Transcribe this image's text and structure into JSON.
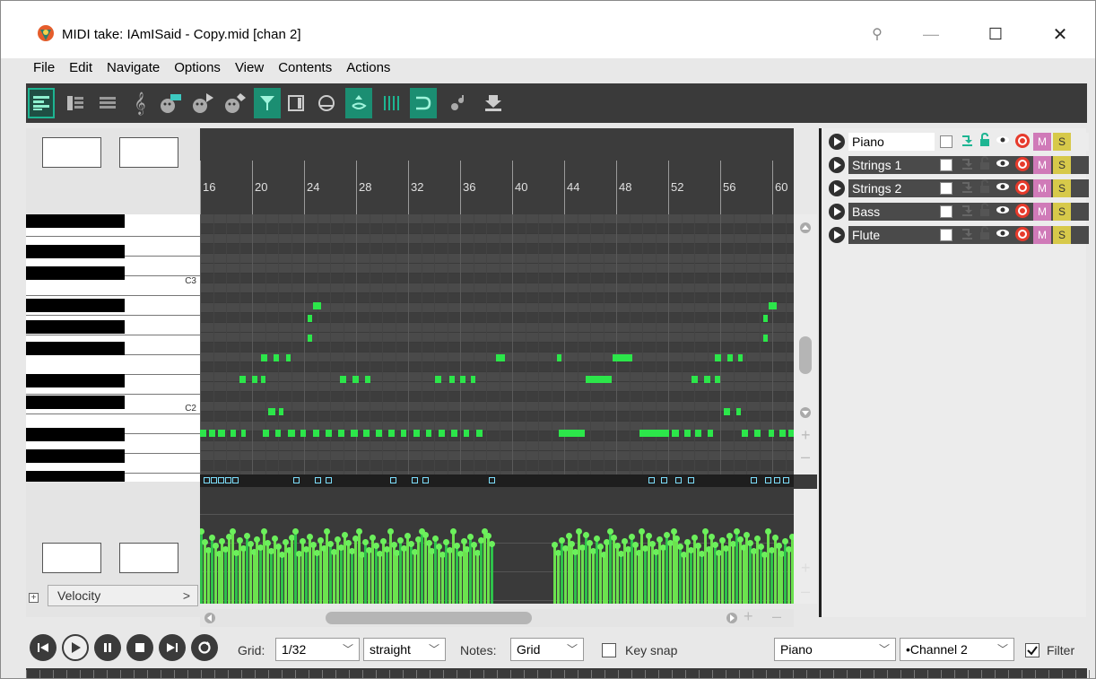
{
  "window": {
    "title": "MIDI take: IAmISaid - Copy.mid [chan 2]",
    "pin_icon": "pin-icon",
    "min_label": "—",
    "max_label": "☐",
    "close_label": "✕"
  },
  "menu": [
    "File",
    "Edit",
    "Navigate",
    "Options",
    "View",
    "Contents",
    "Actions"
  ],
  "ruler": {
    "bars": [
      "16",
      "20",
      "24",
      "28",
      "32",
      "36",
      "40",
      "44",
      "48",
      "52",
      "56",
      "60"
    ]
  },
  "keys": {
    "c3": "C3",
    "c2": "C2"
  },
  "lane": {
    "velocity_label": "Velocity",
    "chevron": ">"
  },
  "tracks": [
    {
      "name": "Piano",
      "m": "M",
      "s": "S",
      "selected": true
    },
    {
      "name": "Strings 1",
      "m": "M",
      "s": "S",
      "selected": false
    },
    {
      "name": "Strings 2",
      "m": "M",
      "s": "S",
      "selected": false
    },
    {
      "name": "Bass",
      "m": "M",
      "s": "S",
      "selected": false
    },
    {
      "name": "Flute",
      "m": "M",
      "s": "S",
      "selected": false
    }
  ],
  "bottom": {
    "grid_label": "Grid:",
    "grid_value": "1/32",
    "grid_type": "straight",
    "notes_label": "Notes:",
    "notes_value": "Grid",
    "key_snap_label": "Key snap",
    "key_snap_checked": false,
    "track_select": "Piano",
    "channel_select": "•Channel 2",
    "filter_label": "Filter",
    "filter_checked": true
  },
  "colors": {
    "note": "#2ce64a",
    "accent": "#1db592",
    "track_record": "#e63a2b",
    "track_mute": "#d07ab8",
    "track_solo": "#d7c94a"
  }
}
